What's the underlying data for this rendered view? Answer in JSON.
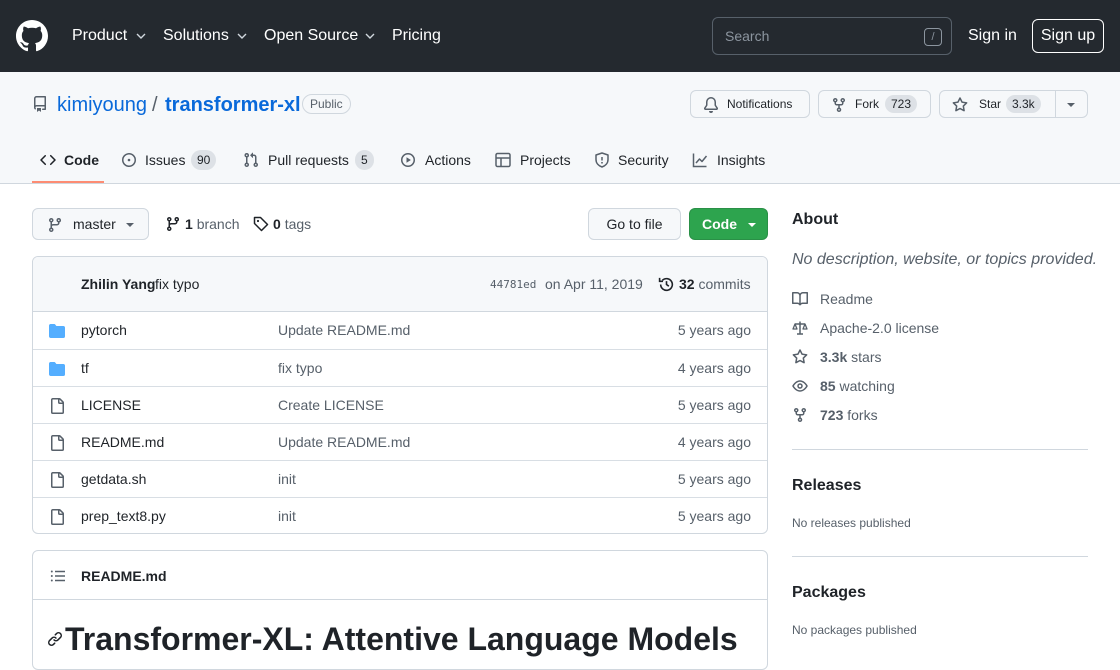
{
  "header": {
    "nav": [
      {
        "label": "Product",
        "dropdown": true
      },
      {
        "label": "Solutions",
        "dropdown": true
      },
      {
        "label": "Open Source",
        "dropdown": true
      },
      {
        "label": "Pricing",
        "dropdown": false
      }
    ],
    "search_placeholder": "Search",
    "search_shortcut": "/",
    "sign_in": "Sign in",
    "sign_up": "Sign up"
  },
  "repo": {
    "owner": "kimiyoung",
    "separator": "/",
    "name": "transformer-xl",
    "visibility": "Public",
    "notifications_label": "Notifications",
    "fork_label": "Fork",
    "fork_count": "723",
    "star_label": "Star",
    "star_count": "3.3k"
  },
  "tabs": [
    {
      "label": "Code",
      "icon": "code-icon",
      "selected": true
    },
    {
      "label": "Issues",
      "icon": "issue-icon",
      "count": "90"
    },
    {
      "label": "Pull requests",
      "icon": "pull-request-icon",
      "count": "5"
    },
    {
      "label": "Actions",
      "icon": "play-icon"
    },
    {
      "label": "Projects",
      "icon": "table-icon"
    },
    {
      "label": "Security",
      "icon": "shield-icon"
    },
    {
      "label": "Insights",
      "icon": "graph-icon"
    }
  ],
  "branch_bar": {
    "branch": "master",
    "branch_count": "1",
    "branch_word": "branch",
    "tag_count": "0",
    "tag_word": "tags",
    "go_to_file": "Go to file",
    "code_button": "Code"
  },
  "latest_commit": {
    "author": "Zhilin Yang",
    "message": "fix typo",
    "sha": "44781ed",
    "date": "on Apr 11, 2019",
    "commit_count": "32",
    "commit_word": "commits"
  },
  "files": [
    {
      "name": "pytorch",
      "type": "dir",
      "message": "Update README.md",
      "age": "5 years ago"
    },
    {
      "name": "tf",
      "type": "dir",
      "message": "fix typo",
      "age": "4 years ago"
    },
    {
      "name": "LICENSE",
      "type": "file",
      "message": "Create LICENSE",
      "age": "5 years ago"
    },
    {
      "name": "README.md",
      "type": "file",
      "message": "Update README.md",
      "age": "4 years ago"
    },
    {
      "name": "getdata.sh",
      "type": "file",
      "message": "init",
      "age": "5 years ago"
    },
    {
      "name": "prep_text8.py",
      "type": "file",
      "message": "init",
      "age": "5 years ago"
    }
  ],
  "readme": {
    "filename": "README.md",
    "heading": "Transformer-XL: Attentive Language Models"
  },
  "sidebar": {
    "about_title": "About",
    "description": "No description, website, or topics provided.",
    "readme_label": "Readme",
    "license_label": "Apache-2.0 license",
    "stars_count": "3.3k",
    "stars_word": "stars",
    "watching_count": "85",
    "watching_word": "watching",
    "forks_count": "723",
    "forks_word": "forks",
    "releases_title": "Releases",
    "releases_empty": "No releases published",
    "packages_title": "Packages",
    "packages_empty": "No packages published"
  },
  "colors": {
    "header_bg": "#24292f",
    "link": "#0969da",
    "primary_button": "#2da44e",
    "folder": "#54aeff",
    "tab_underline": "#fd8c73"
  }
}
